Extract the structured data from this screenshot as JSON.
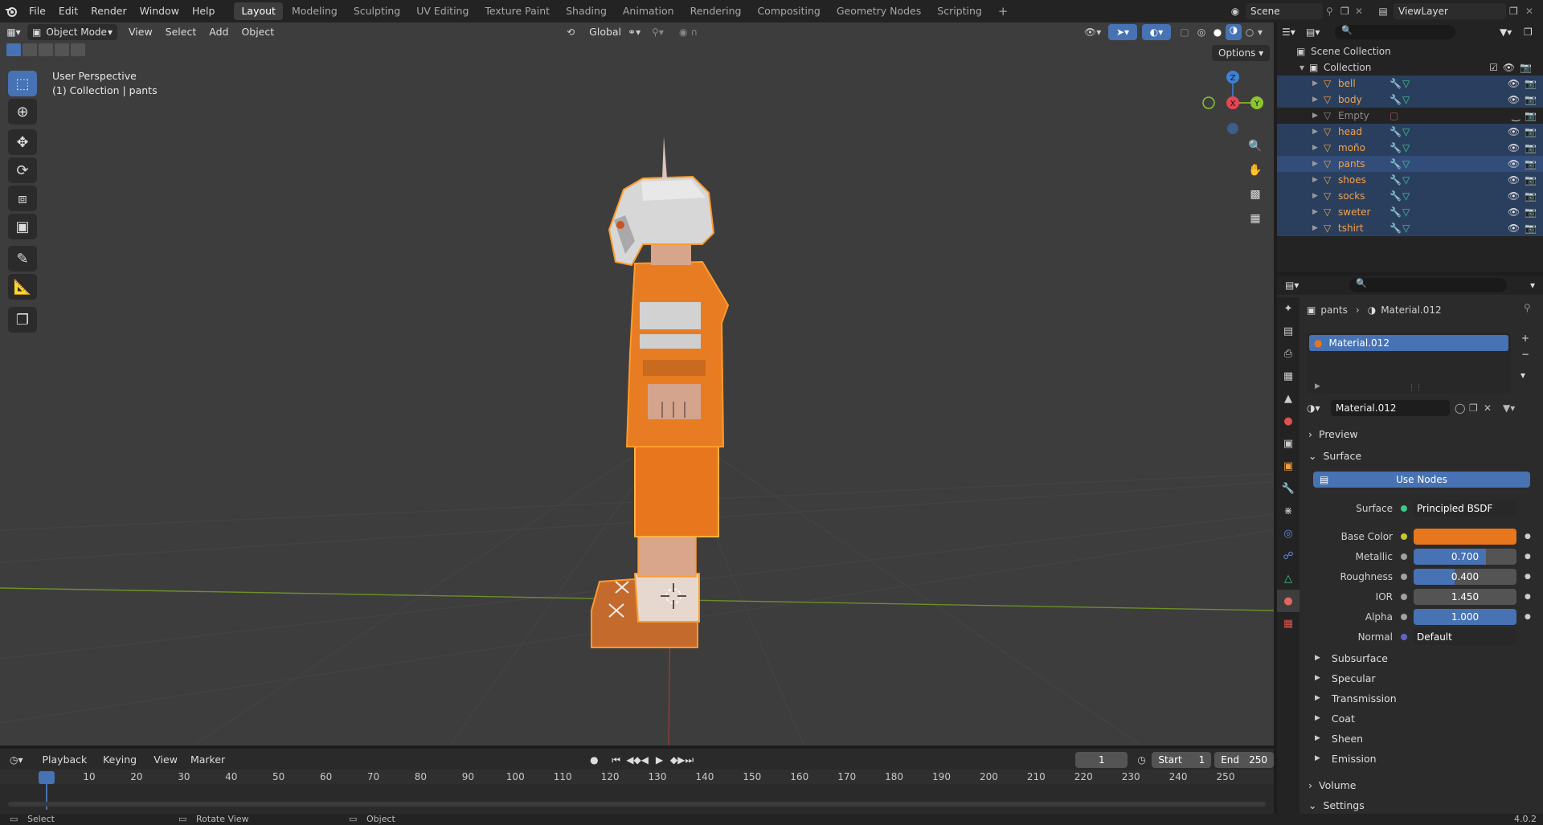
{
  "topbar": {
    "menus": [
      "File",
      "Edit",
      "Render",
      "Window",
      "Help"
    ],
    "workspaces": [
      "Layout",
      "Modeling",
      "Sculpting",
      "UV Editing",
      "Texture Paint",
      "Shading",
      "Animation",
      "Rendering",
      "Compositing",
      "Geometry Nodes",
      "Scripting"
    ],
    "active_workspace": "Layout",
    "add_tab": "+",
    "scene": "Scene",
    "view_layer": "ViewLayer"
  },
  "viewport": {
    "mode": "Object Mode",
    "menus": [
      "View",
      "Select",
      "Add",
      "Object"
    ],
    "orientation": "Global",
    "options": "Options",
    "perspective": "User Perspective",
    "collection_info": "(1) Collection | pants",
    "gizmo": {
      "z": "Z",
      "x": "X",
      "y": "Y"
    }
  },
  "toolbar": {
    "tools": [
      "select-box-icon",
      "cursor-icon",
      "move-icon",
      "rotate-icon",
      "scale-icon",
      "transform-icon",
      "annotate-icon",
      "measure-icon",
      "add-cube-icon"
    ]
  },
  "outliner": {
    "root": "Scene Collection",
    "collection": "Collection",
    "items": [
      {
        "name": "bell",
        "state": "sel"
      },
      {
        "name": "body",
        "state": "sel"
      },
      {
        "name": "Empty",
        "state": "dim"
      },
      {
        "name": "head",
        "state": "sel"
      },
      {
        "name": "moño",
        "state": "sel"
      },
      {
        "name": "pants",
        "state": "hl"
      },
      {
        "name": "shoes",
        "state": "sel"
      },
      {
        "name": "socks",
        "state": "sel"
      },
      {
        "name": "sweter",
        "state": "sel"
      },
      {
        "name": "tshirt",
        "state": "sel"
      }
    ]
  },
  "properties": {
    "breadcrumb_object": "pants",
    "breadcrumb_material": "Material.012",
    "slot": "Material.012",
    "material_name": "Material.012",
    "preview_label": "Preview",
    "surface_label": "Surface",
    "use_nodes": "Use Nodes",
    "surface_field_label": "Surface",
    "surface_value": "Principled BSDF",
    "base_color_label": "Base Color",
    "base_color": "#e8761d",
    "metallic_label": "Metallic",
    "metallic": "0.700",
    "metallic_fill": 0.7,
    "roughness_label": "Roughness",
    "roughness": "0.400",
    "roughness_fill": 0.4,
    "ior_label": "IOR",
    "ior": "1.450",
    "alpha_label": "Alpha",
    "alpha": "1.000",
    "alpha_fill": 1.0,
    "normal_label": "Normal",
    "normal": "Default",
    "subpanels": [
      "Subsurface",
      "Specular",
      "Transmission",
      "Coat",
      "Sheen",
      "Emission"
    ],
    "volume_label": "Volume",
    "settings_label": "Settings"
  },
  "timeline": {
    "menus": [
      "Playback",
      "Keying",
      "View",
      "Marker"
    ],
    "current_frame": "1",
    "start_label": "Start",
    "start": "1",
    "end_label": "End",
    "end": "250",
    "ticks": [
      "1",
      "10",
      "20",
      "30",
      "40",
      "50",
      "60",
      "70",
      "80",
      "90",
      "100",
      "110",
      "120",
      "130",
      "140",
      "150",
      "160",
      "170",
      "180",
      "190",
      "200",
      "210",
      "220",
      "230",
      "240",
      "250"
    ]
  },
  "statusbar": {
    "select": "Select",
    "rotate": "Rotate View",
    "object": "Object",
    "version": "4.0.2"
  },
  "colors": {
    "accent": "#4772b3",
    "selection_orange": "#f08a1e",
    "viewport_bg": "#3d3d3d"
  }
}
